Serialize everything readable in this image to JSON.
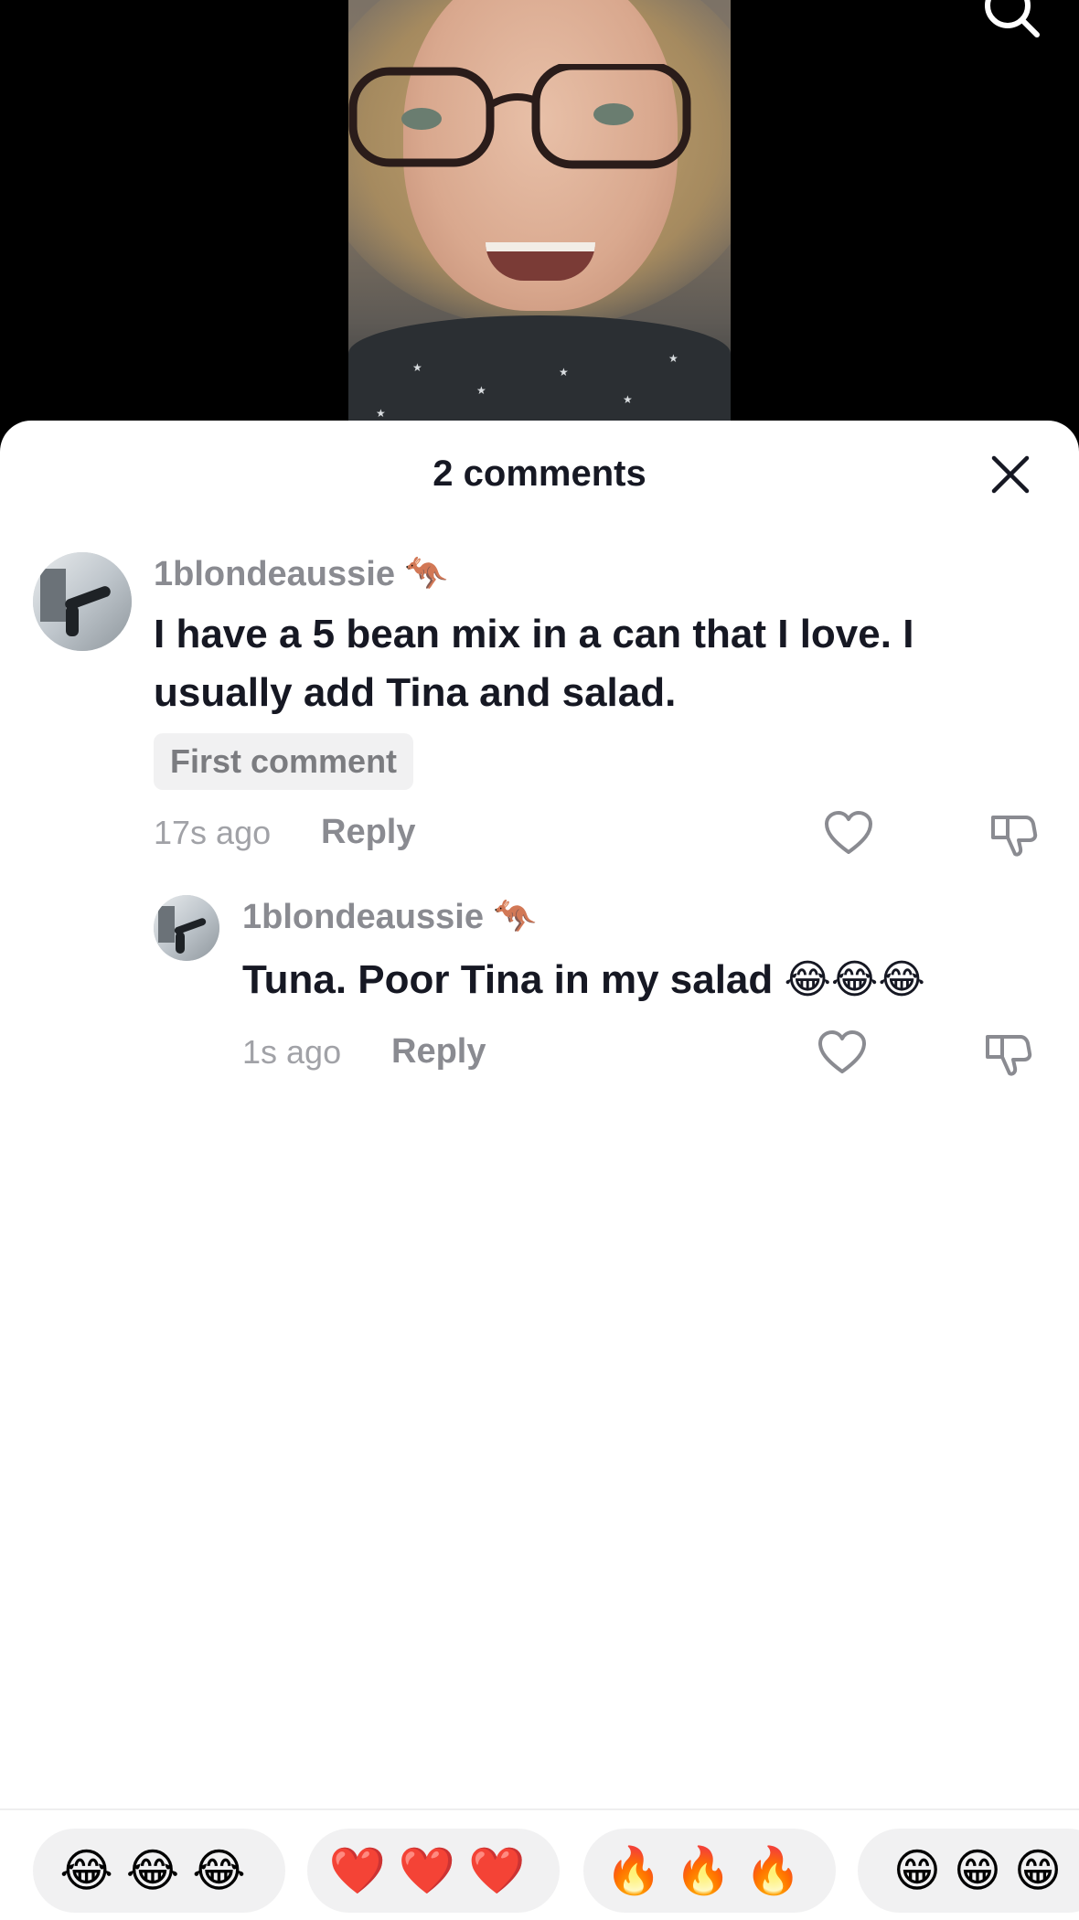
{
  "video": {
    "search_icon": "search-icon"
  },
  "sheet": {
    "title": "2 comments",
    "close_icon": "close-icon"
  },
  "comments": [
    {
      "username": "1blondeaussie 🦘",
      "text": "I have a 5 bean mix in a can that I love. I usually add Tina and salad.",
      "badge": "First comment",
      "time": "17s ago",
      "reply_label": "Reply"
    },
    {
      "username": "1blondeaussie 🦘",
      "text": "Tuna. Poor Tina in my salad 😂😂😂",
      "time": "1s ago",
      "reply_label": "Reply"
    }
  ],
  "quick_emojis": [
    "😂😂😂",
    "❤️❤️❤️",
    "🔥🔥🔥",
    "😁😁😁"
  ]
}
